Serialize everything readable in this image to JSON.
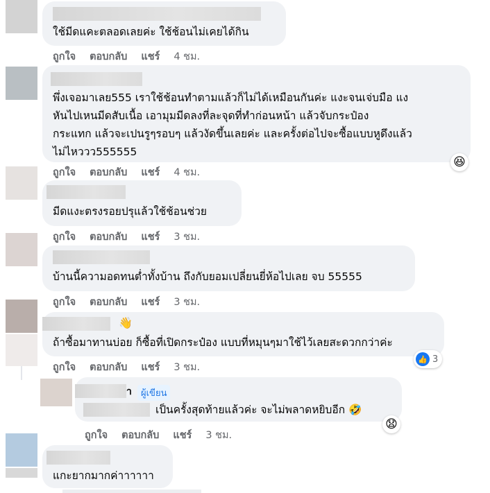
{
  "labels": {
    "like": "ถูกใจ",
    "reply": "ตอบกลับ",
    "share": "แชร์"
  },
  "comments": [
    {
      "text_lines": [
        "ใช้มีดแคะตลอดเลยค่ะ ใช้ช้อนไม่เคยได้กิน"
      ],
      "time": "4 ชม."
    },
    {
      "text_lines": [
        "พึ่งเจอมาเลย555 เราใช้ช้อนทำตามแล้วก็ไม่ได้เหมือนกันค่ะ แงะจนเจ่บมือ แง",
        "หันไปเหนมีดสับเนื้อ เอามุมมีดลงที่ละจุดที่ทำก่อนหน้า แล้วจับกระป๋อง",
        "กระแทก แล้วจะเปนรูๆรอบๆ แล้วงัดขึ้นเลยค่ะ และครั้งต่อไปจะซื้อแบบหูดึงแล้ว",
        "ไม่ไหววว555555"
      ],
      "time": "4 ชม.",
      "reaction": "😆"
    },
    {
      "text_lines": [
        "มีดแงะตรงรอยปรุแล้วใช้ช้อนช่วย"
      ],
      "time": "3 ชม."
    },
    {
      "text_lines": [
        "บ้านนี้ความอดทนต่ำทั้งบ้าน ถึงกับยอมเปลี่ยนยี่ห้อไปเลย จบ 55555"
      ],
      "time": "3 ชม."
    },
    {
      "text_lines": [
        "ถ้าซื้อมาทานบ่อย ก็ซื้อที่เปิดกระป๋อง แบบที่หมุนๆมาใช้ไว้เลยสะดวกกว่าค่ะ"
      ],
      "time": "3 ชม.",
      "name_icon": "👋",
      "like_count": "3"
    },
    {
      "is_reply": true,
      "name_suffix": "า",
      "badge": "ผู้เขียน",
      "text_lines": [
        "เป็นครั้งสุดท้ายแล้วค่ะ จะไม่พลาดหยิบอีก 🤣"
      ],
      "time": "3 ชม.",
      "reaction": "😧"
    },
    {
      "text_lines": [
        "แกะยากมากค่าาาาาา"
      ]
    }
  ]
}
